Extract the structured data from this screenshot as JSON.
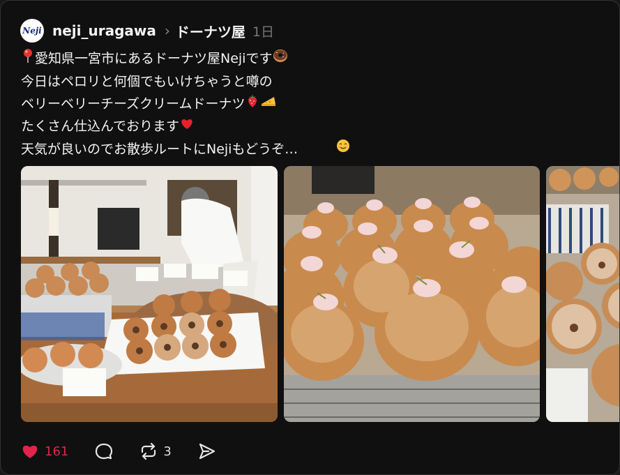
{
  "post": {
    "username": "neji_uragawa",
    "avatar_text": "Neji",
    "topic": "ドーナツ屋",
    "time": "1日",
    "lines": [
      "愛知県一宮市にあるドーナツ屋Nejiです",
      "今日はペロリと何個でもいけちゃうと噂の",
      "ベリーベリーチーズクリームドーナツ",
      "たくさん仕込んでおります",
      "天気が良いのでお散歩ルートにNejiもどうぞ…"
    ],
    "images": [
      {
        "alt": "donut shop counter"
      },
      {
        "alt": "berry cheese cream donuts"
      },
      {
        "alt": "sugar donuts"
      }
    ]
  },
  "actions": {
    "like_count": "161",
    "repost_count": "3"
  },
  "icons": [
    "pin-icon",
    "donut-icon",
    "strawberry-icon",
    "cheese-icon",
    "heart-emoji-icon",
    "smile-icon",
    "heart-icon",
    "comment-icon",
    "repost-icon",
    "share-icon",
    "chevron-right-icon"
  ],
  "colors": {
    "accent_like": "#e0244a",
    "background": "#101010",
    "text": "#f3f3f3"
  }
}
